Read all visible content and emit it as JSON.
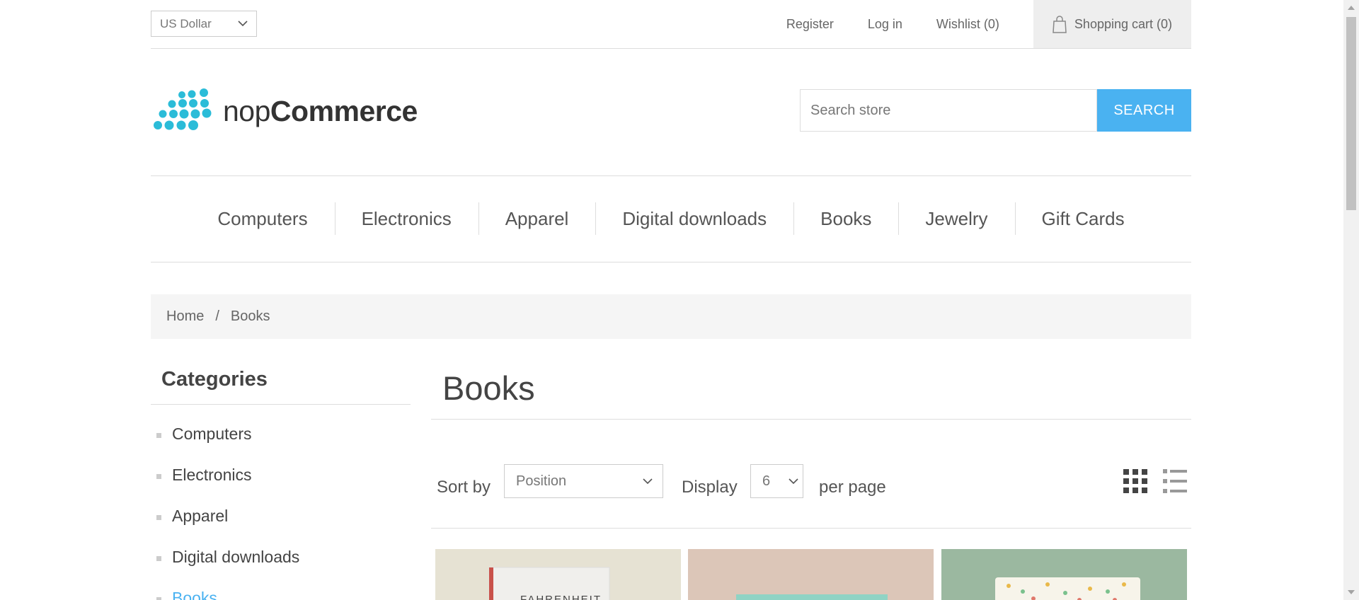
{
  "header": {
    "currency": "US Dollar",
    "links": {
      "register": "Register",
      "login": "Log in",
      "wishlist": "Wishlist (0)",
      "cart": "Shopping cart (0)"
    }
  },
  "logo": {
    "light": "nop",
    "bold": "Commerce"
  },
  "search": {
    "placeholder": "Search store",
    "button": "SEARCH"
  },
  "top_menu": [
    "Computers",
    "Electronics",
    "Apparel",
    "Digital downloads",
    "Books",
    "Jewelry",
    "Gift Cards"
  ],
  "breadcrumb": {
    "home": "Home",
    "separator": "/",
    "current": "Books"
  },
  "side": {
    "title": "Categories",
    "items": [
      "Computers",
      "Electronics",
      "Apparel",
      "Digital downloads",
      "Books"
    ]
  },
  "main": {
    "title": "Books",
    "sort_label": "Sort by",
    "sort_value": "Position",
    "display_label": "Display",
    "display_value": "6",
    "per_page_label": "per page",
    "book1_cover_text": "FAHRENHEIT"
  },
  "colors": {
    "accent": "#4ab2f1",
    "logo_dots": "#2bbcd8"
  }
}
